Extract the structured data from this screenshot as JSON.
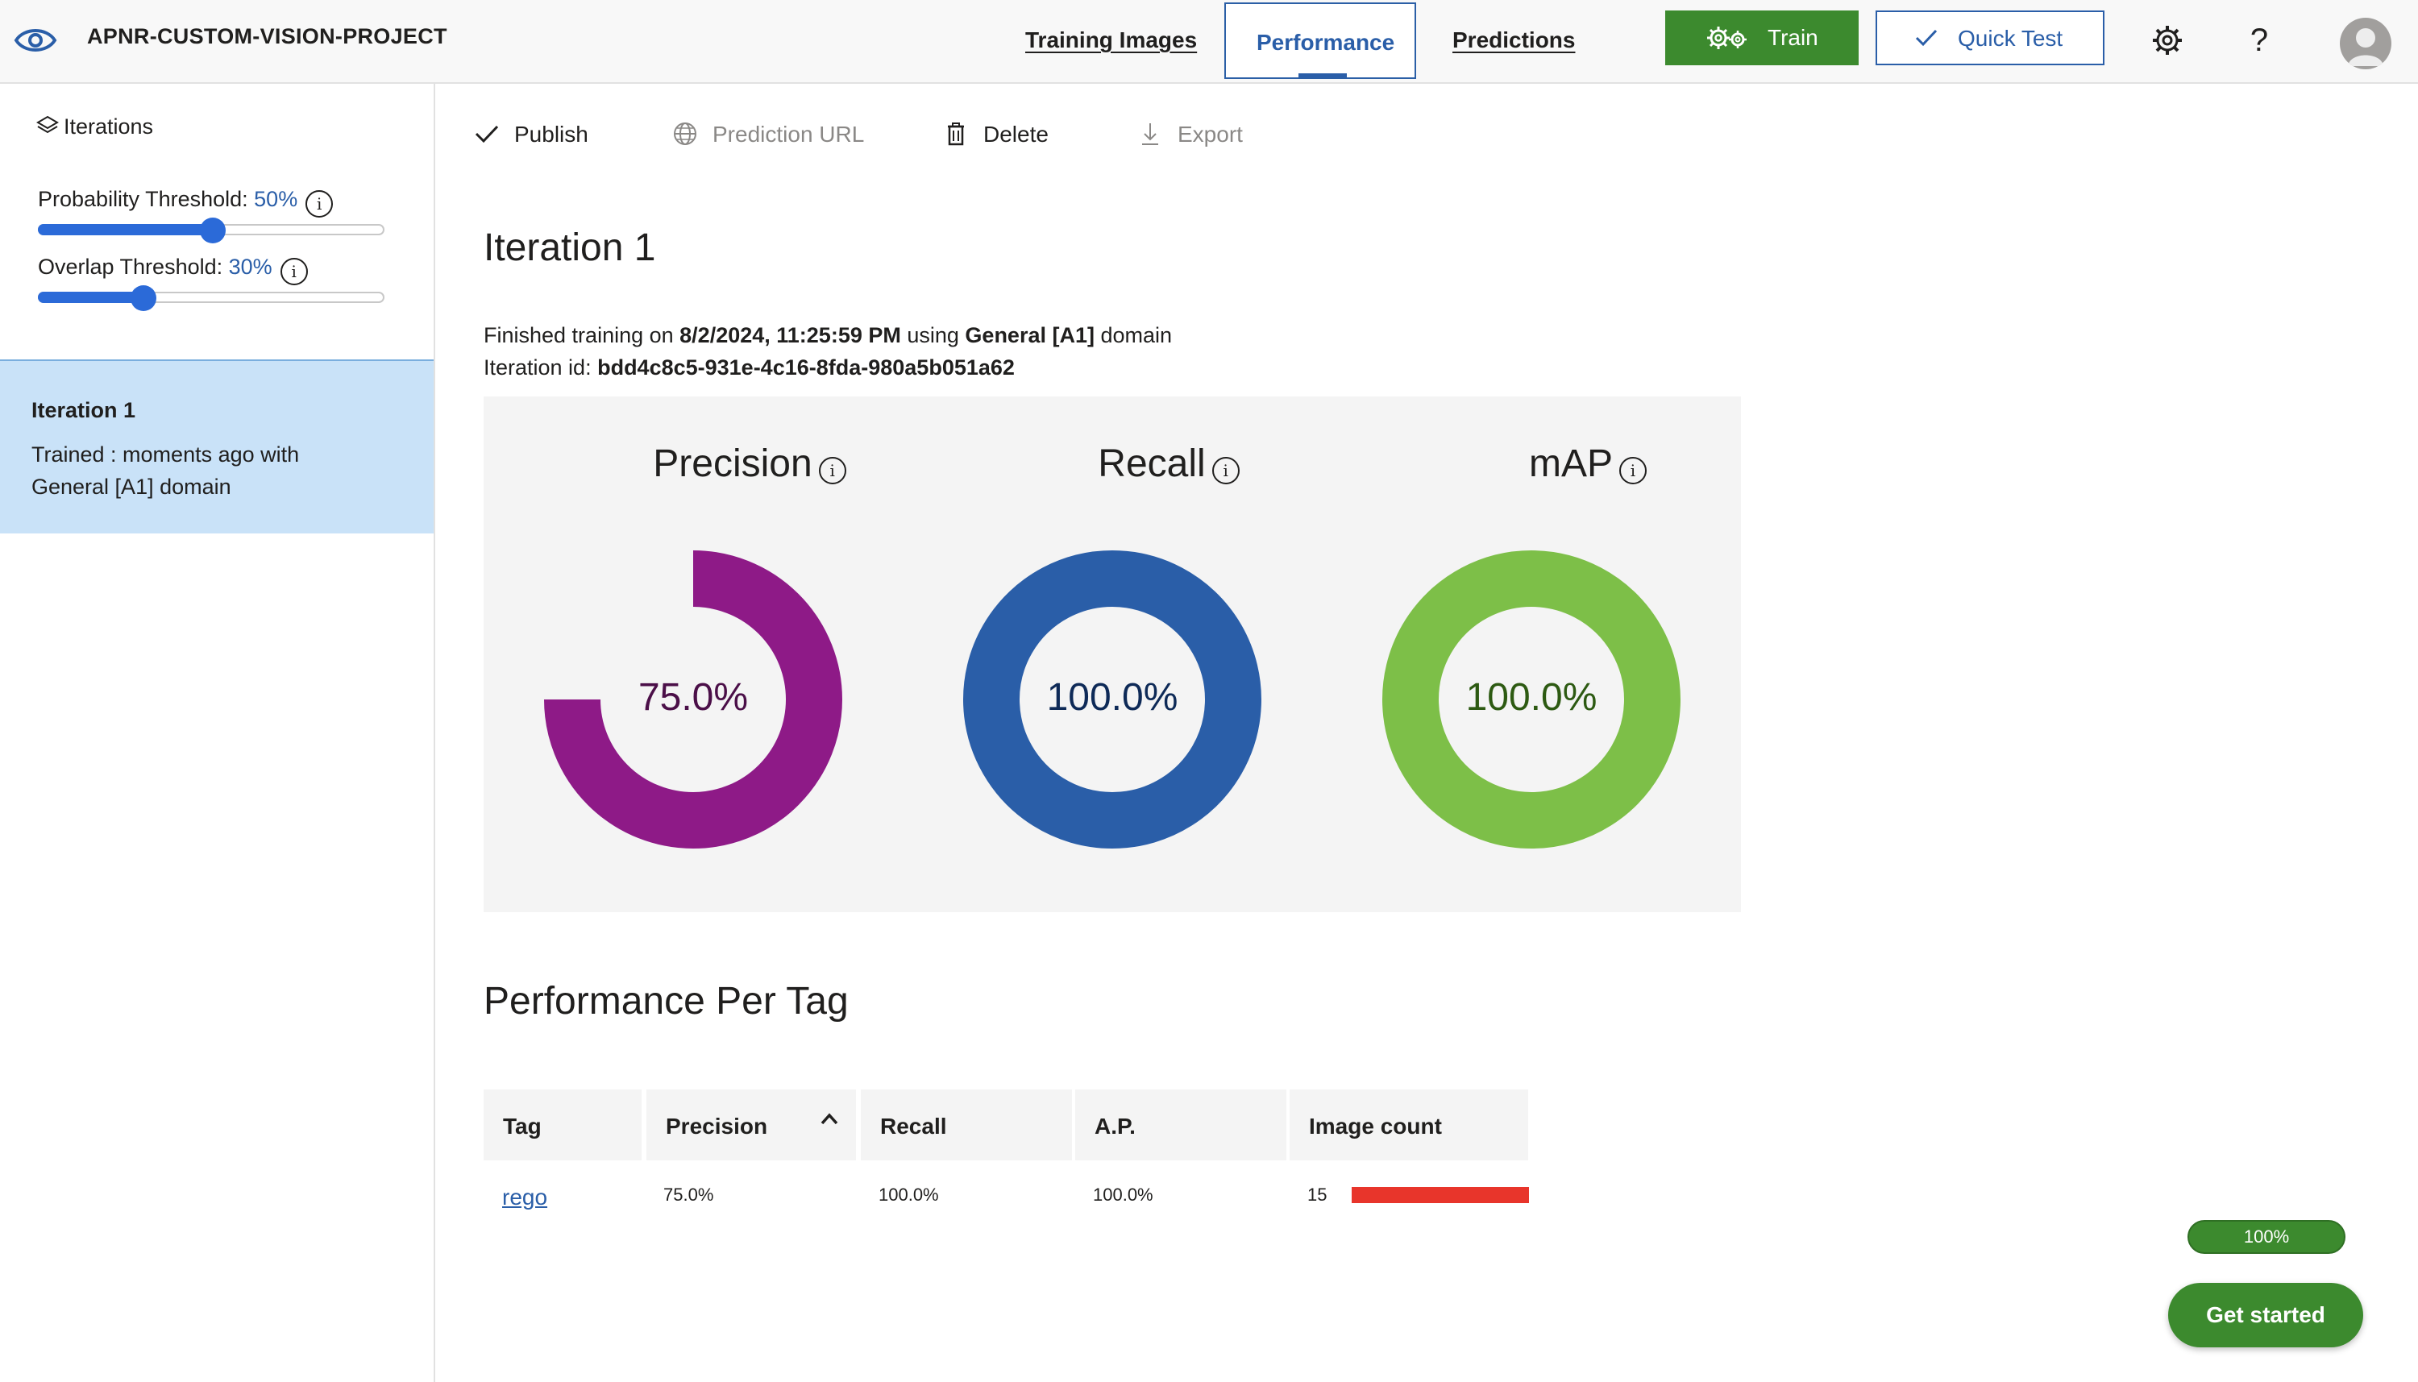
{
  "header": {
    "project_title": "APNR-CUSTOM-VISION-PROJECT",
    "nav": {
      "training_images": "Training Images",
      "performance": "Performance",
      "predictions": "Predictions"
    },
    "train_label": "Train",
    "quick_test_label": "Quick Test",
    "help_glyph": "?",
    "icons": [
      "eye-logo-icon",
      "gear-icon",
      "help-icon",
      "user-avatar-icon"
    ]
  },
  "sidebar": {
    "iterations_label": "Iterations",
    "probability": {
      "label": "Probability Threshold: ",
      "value_text": "50%",
      "value": 0.5
    },
    "overlap": {
      "label": "Overlap Threshold: ",
      "value_text": "30%",
      "value": 0.3
    },
    "info_glyph": "i",
    "iteration": {
      "name": "Iteration 1",
      "description": "Trained : moments ago with General [A1] domain"
    }
  },
  "toolbar": {
    "publish": "Publish",
    "prediction_url": "Prediction URL",
    "delete": "Delete",
    "export": "Export"
  },
  "main": {
    "iteration_title": "Iteration 1",
    "finished_prefix": "Finished training on ",
    "finished_date": "8/2/2024, 11:25:59 PM",
    "finished_mid": " using ",
    "finished_domain": "General [A1]",
    "finished_suffix": " domain",
    "iteration_id_label": "Iteration id: ",
    "iteration_id": "bdd4c8c5-931e-4c16-8fda-980a5b051a62",
    "metrics": [
      {
        "name": "Precision",
        "value": 75.0,
        "label": "75.0%",
        "color": "#8e1a87",
        "text_color": "#4b0f48"
      },
      {
        "name": "Recall",
        "value": 100.0,
        "label": "100.0%",
        "color": "#2a5ea8",
        "text_color": "#0e2a57"
      },
      {
        "name": "mAP",
        "value": 100.0,
        "label": "100.0%",
        "color": "#7dbf48",
        "text_color": "#2d5a12"
      }
    ],
    "per_tag_title": "Performance Per Tag",
    "table": {
      "headers": [
        "Tag",
        "Precision",
        "Recall",
        "A.P.",
        "Image count"
      ],
      "rows": [
        {
          "tag": "rego",
          "precision": "75.0%",
          "recall": "100.0%",
          "ap": "100.0%",
          "image_count": "15"
        }
      ]
    }
  },
  "footer": {
    "progress_label": "100%",
    "progress_value": 1.0,
    "get_started": "Get started"
  },
  "colors": {
    "accent": "#2a5ea8",
    "train_green": "#3c8a2e",
    "selected_iteration_bg": "#c9e2f8",
    "image_count_bar": "#e8352b"
  }
}
